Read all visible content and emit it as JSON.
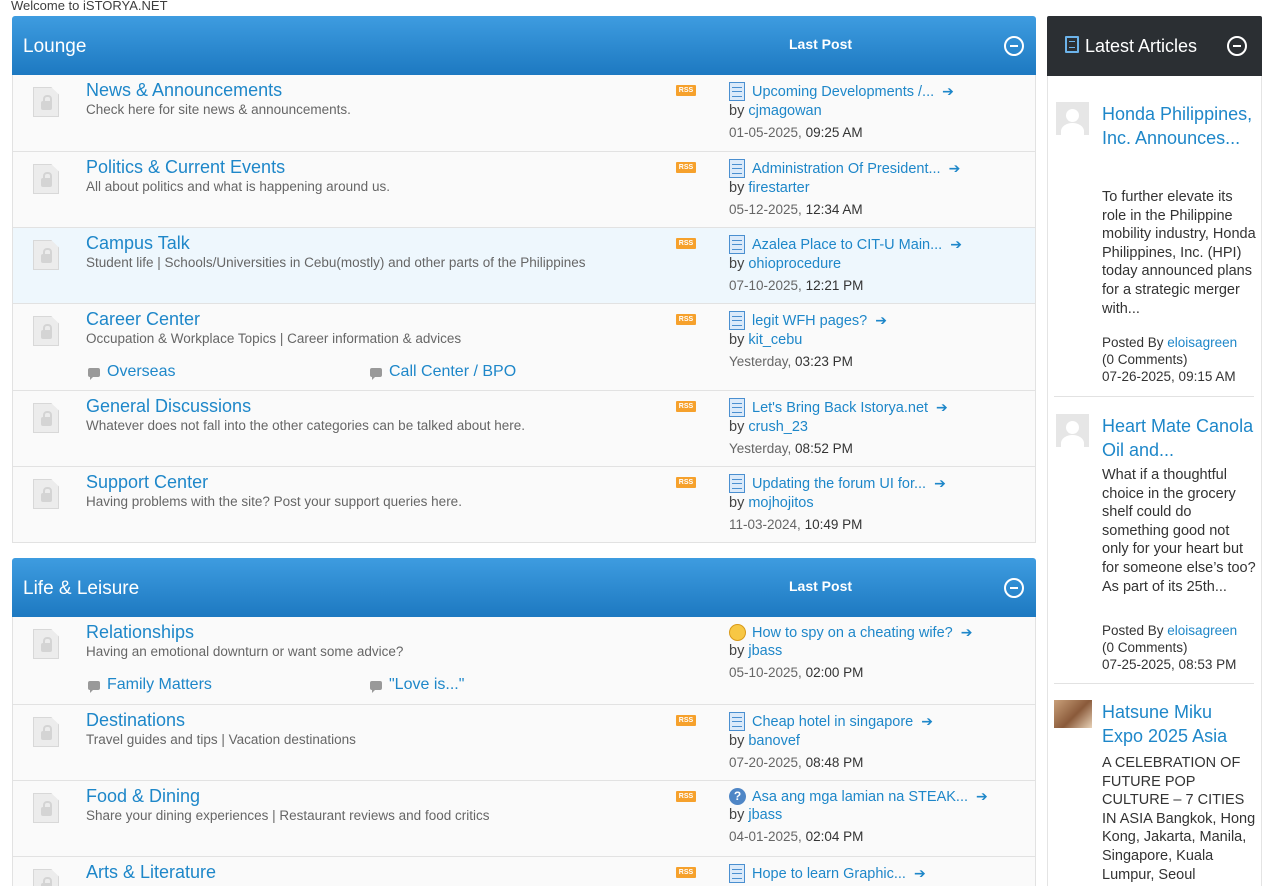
{
  "welcome": "Welcome to iSTORYA.NET",
  "categories": [
    {
      "title": "Lounge",
      "lastpost_header": "Last Post",
      "forums": [
        {
          "title": "News & Announcements",
          "desc": "Check here for site news & announcements.",
          "rss": "RSS",
          "lp_title": "Upcoming Developments /...",
          "lp_by": "by ",
          "lp_user": "cjmagowan",
          "lp_date": "01-05-2025, ",
          "lp_time": "09:25 AM"
        },
        {
          "title": "Politics & Current Events",
          "desc": "All about politics and what is happening around us.",
          "rss": "RSS",
          "lp_title": "Administration Of President...",
          "lp_by": "by ",
          "lp_user": "firestarter",
          "lp_date": "05-12-2025, ",
          "lp_time": "12:34 AM"
        },
        {
          "title": "Campus Talk",
          "desc": "Student life | Schools/Universities in Cebu(mostly) and other parts of the Philippines",
          "rss": "RSS",
          "lp_title": "Azalea Place to CIT-U Main...",
          "lp_by": "by ",
          "lp_user": "ohioprocedure",
          "lp_date": "07-10-2025, ",
          "lp_time": "12:21 PM"
        },
        {
          "title": "Career Center",
          "desc": "Occupation & Workplace Topics | Career information & advices",
          "rss": "RSS",
          "sub1": "Overseas",
          "sub2": "Call Center / BPO",
          "lp_title": "legit WFH pages?",
          "lp_by": "by ",
          "lp_user": "kit_cebu",
          "lp_date": "Yesterday, ",
          "lp_time": "03:23 PM"
        },
        {
          "title": "General Discussions",
          "desc": "Whatever does not fall into the other categories can be talked about here.",
          "rss": "RSS",
          "lp_title": "Let's Bring Back Istorya.net",
          "lp_by": "by ",
          "lp_user": "crush_23",
          "lp_date": "Yesterday, ",
          "lp_time": "08:52 PM"
        },
        {
          "title": "Support Center",
          "desc": "Having problems with the site? Post your support queries here.",
          "rss": "RSS",
          "lp_title": "Updating the forum UI for...",
          "lp_by": "by ",
          "lp_user": "mojhojitos",
          "lp_date": "11-03-2024, ",
          "lp_time": "10:49 PM"
        }
      ]
    },
    {
      "title": "Life & Leisure",
      "lastpost_header": "Last Post",
      "forums": [
        {
          "title": "Relationships",
          "desc": "Having an emotional downturn or want some advice?",
          "sub1": "Family Matters",
          "sub2": "\"Love is...\"",
          "lp_title": "How to spy on a cheating wife?",
          "lp_by": "by ",
          "lp_user": "jbass",
          "lp_date": "05-10-2025, ",
          "lp_time": "02:00 PM"
        },
        {
          "title": "Destinations",
          "desc": "Travel guides and tips | Vacation destinations",
          "rss": "RSS",
          "lp_title": "Cheap hotel in singapore",
          "lp_by": "by ",
          "lp_user": "banovef",
          "lp_date": "07-20-2025, ",
          "lp_time": "08:48 PM"
        },
        {
          "title": "Food & Dining",
          "desc": "Share your dining experiences | Restaurant reviews and food critics",
          "rss": "RSS",
          "lp_title": "Asa ang mga lamian na STEAK...",
          "lp_by": "by ",
          "lp_user": "jbass",
          "lp_date": "04-01-2025, ",
          "lp_time": "02:04 PM"
        },
        {
          "title": "Arts & Literature",
          "rss": "RSS",
          "lp_title": "Hope to learn Graphic..."
        }
      ]
    }
  ],
  "sidebar": {
    "title": "Latest Articles",
    "articles": [
      {
        "title": "Honda Philippines, Inc. Announces...",
        "body": "To further elevate its role in the Philippine mobility industry, Honda Philippines, Inc. (HPI) today announced plans for a strategic merger with...",
        "posted_by": "Posted By ",
        "author": "eloisagreen",
        "comments": "(0 Comments)",
        "date": "07-26-2025, 09:15 AM"
      },
      {
        "title": "Heart Mate Canola Oil and...",
        "body": "What if a thoughtful choice in the grocery shelf could do something good not only for your heart but for someone else’s too? As part of its 25th...",
        "posted_by": "Posted By ",
        "author": "eloisagreen",
        "comments": "(0 Comments)",
        "date": "07-25-2025, 08:53 PM"
      },
      {
        "title": "Hatsune Miku Expo 2025 Asia",
        "body": "A CELEBRATION OF FUTURE POP CULTURE – 7 CITIES IN ASIA Bangkok, Hong Kong, Jakarta, Manila, Singapore, Kuala Lumpur, Seoul"
      }
    ]
  },
  "icons": {
    "forum": "forum-lock-icon",
    "post": "page-icon",
    "smile": "smile-icon",
    "question": "question-icon",
    "goto": "arrow-right-icon",
    "collapse": "collapse-icon"
  },
  "colors": {
    "link": "#1e87c9",
    "header": "#2b8ad6",
    "sidebar_header": "#2b2f33",
    "rss": "#f6a12c"
  }
}
